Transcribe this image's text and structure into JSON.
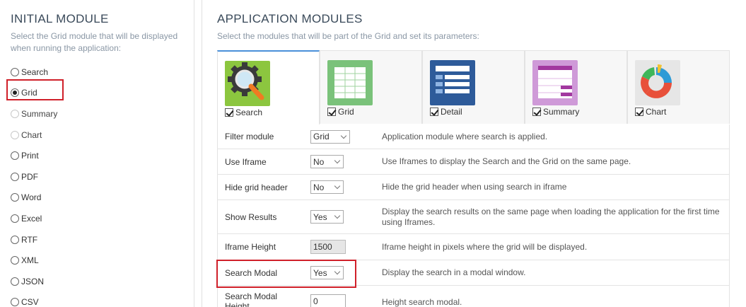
{
  "initial_module": {
    "title": "INITIAL MODULE",
    "description": "Select the Grid module that will be displayed when running the application:",
    "options": [
      {
        "label": "Search",
        "state": "unchecked"
      },
      {
        "label": "Grid",
        "state": "checked"
      },
      {
        "label": "Summary",
        "state": "disabled"
      },
      {
        "label": "Chart",
        "state": "disabled"
      },
      {
        "label": "Print",
        "state": "unchecked"
      },
      {
        "label": "PDF",
        "state": "unchecked"
      },
      {
        "label": "Word",
        "state": "unchecked"
      },
      {
        "label": "Excel",
        "state": "unchecked"
      },
      {
        "label": "RTF",
        "state": "unchecked"
      },
      {
        "label": "XML",
        "state": "unchecked"
      },
      {
        "label": "JSON",
        "state": "unchecked"
      },
      {
        "label": "CSV",
        "state": "unchecked"
      }
    ]
  },
  "application_modules": {
    "title": "APPLICATION MODULES",
    "description": "Select the modules that will be part of the Grid and set its parameters:",
    "tabs": [
      {
        "label": "Search",
        "icon": "search-gear-icon",
        "color": "#8cc63f",
        "checked": true
      },
      {
        "label": "Grid",
        "icon": "grid-table-icon",
        "color": "#7ac27a",
        "checked": true
      },
      {
        "label": "Detail",
        "icon": "detail-list-icon",
        "color": "#2e5b9a",
        "checked": true
      },
      {
        "label": "Summary",
        "icon": "summary-table-icon",
        "color": "#cf9ad8",
        "checked": true
      },
      {
        "label": "Chart",
        "icon": "donut-chart-icon",
        "color": "#e6e6e6",
        "checked": true
      }
    ],
    "properties": [
      {
        "name": "Filter module",
        "type": "select",
        "value": "Grid",
        "description": "Application module where search is applied."
      },
      {
        "name": "Use Iframe",
        "type": "select",
        "value": "No",
        "description": "Use Iframes to display the Search and the Grid on the same page."
      },
      {
        "name": "Hide grid header",
        "type": "select",
        "value": "No",
        "description": "Hide the grid header when using search in iframe"
      },
      {
        "name": "Show Results",
        "type": "select",
        "value": "Yes",
        "description": "Display the search results on the same page when loading the application for the first time using Iframes."
      },
      {
        "name": "Iframe Height",
        "type": "text-disabled",
        "value": "1500",
        "description": "Iframe height in pixels where the grid will be displayed."
      },
      {
        "name": "Search Modal",
        "type": "select",
        "value": "Yes",
        "description": "Display the search in a modal window."
      },
      {
        "name": "Search Modal Height",
        "type": "text",
        "value": "0",
        "description": "Height search modal."
      }
    ]
  }
}
